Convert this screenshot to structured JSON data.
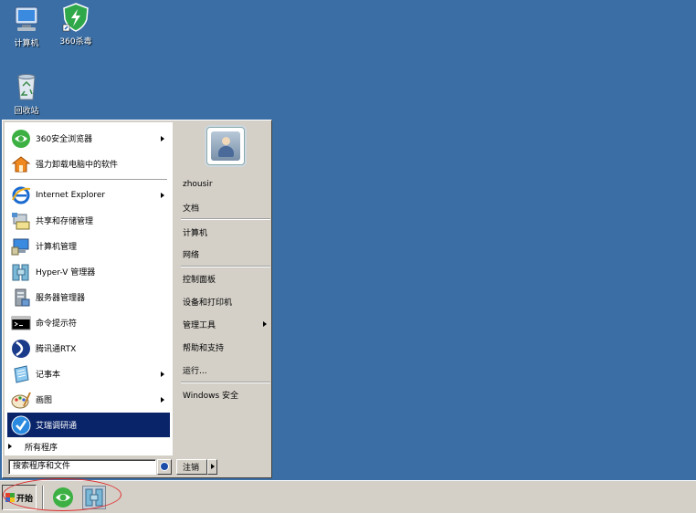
{
  "desktop": {
    "icons": [
      {
        "label": "计算机",
        "icon": "computer-icon"
      },
      {
        "label": "360杀毒",
        "icon": "360-antivirus-icon"
      },
      {
        "label": "回收站",
        "icon": "recycle-bin-icon"
      }
    ]
  },
  "start_menu": {
    "pinned": [
      {
        "label": "360安全浏览器",
        "icon": "360-browser-icon",
        "has_submenu": true
      },
      {
        "label": "强力卸载电脑中的软件",
        "icon": "uninstall-icon",
        "has_submenu": false
      }
    ],
    "recent": [
      {
        "label": "Internet Explorer",
        "icon": "internet-explorer-icon",
        "has_submenu": true
      },
      {
        "label": "共享和存储管理",
        "icon": "share-storage-icon",
        "has_submenu": false
      },
      {
        "label": "计算机管理",
        "icon": "computer-management-icon",
        "has_submenu": false
      },
      {
        "label": "Hyper-V 管理器",
        "icon": "hyperv-icon",
        "has_submenu": false
      },
      {
        "label": "服务器管理器",
        "icon": "server-manager-icon",
        "has_submenu": false
      },
      {
        "label": "命令提示符",
        "icon": "command-prompt-icon",
        "has_submenu": false
      },
      {
        "label": "腾讯通RTX",
        "icon": "rtx-icon",
        "has_submenu": false
      },
      {
        "label": "记事本",
        "icon": "notepad-icon",
        "has_submenu": true
      },
      {
        "label": "画图",
        "icon": "paint-icon",
        "has_submenu": true
      },
      {
        "label": "艾瑞调研通",
        "icon": "iresearch-icon",
        "has_submenu": false,
        "selected": true
      }
    ],
    "all_programs": "所有程序",
    "search_placeholder": "搜索程序和文件",
    "right": {
      "username": "zhousir",
      "items": [
        {
          "label": "文档"
        },
        {
          "label": "计算机"
        },
        {
          "label": "网络"
        },
        {
          "label": "控制面板"
        },
        {
          "label": "设备和打印机"
        },
        {
          "label": "管理工具",
          "has_submenu": true
        },
        {
          "label": "帮助和支持"
        },
        {
          "label": "运行..."
        },
        {
          "label": "Windows 安全"
        }
      ]
    },
    "logoff_label": "注销"
  },
  "taskbar": {
    "start_label": "开始",
    "quick_launch": [
      {
        "icon": "360-browser-icon"
      },
      {
        "icon": "hyperv-icon"
      }
    ]
  },
  "colors": {
    "desktop": "#3a6ea5",
    "menu_face": "#d4d0c8",
    "selection": "#0a246a",
    "annotation": "#e03030"
  }
}
